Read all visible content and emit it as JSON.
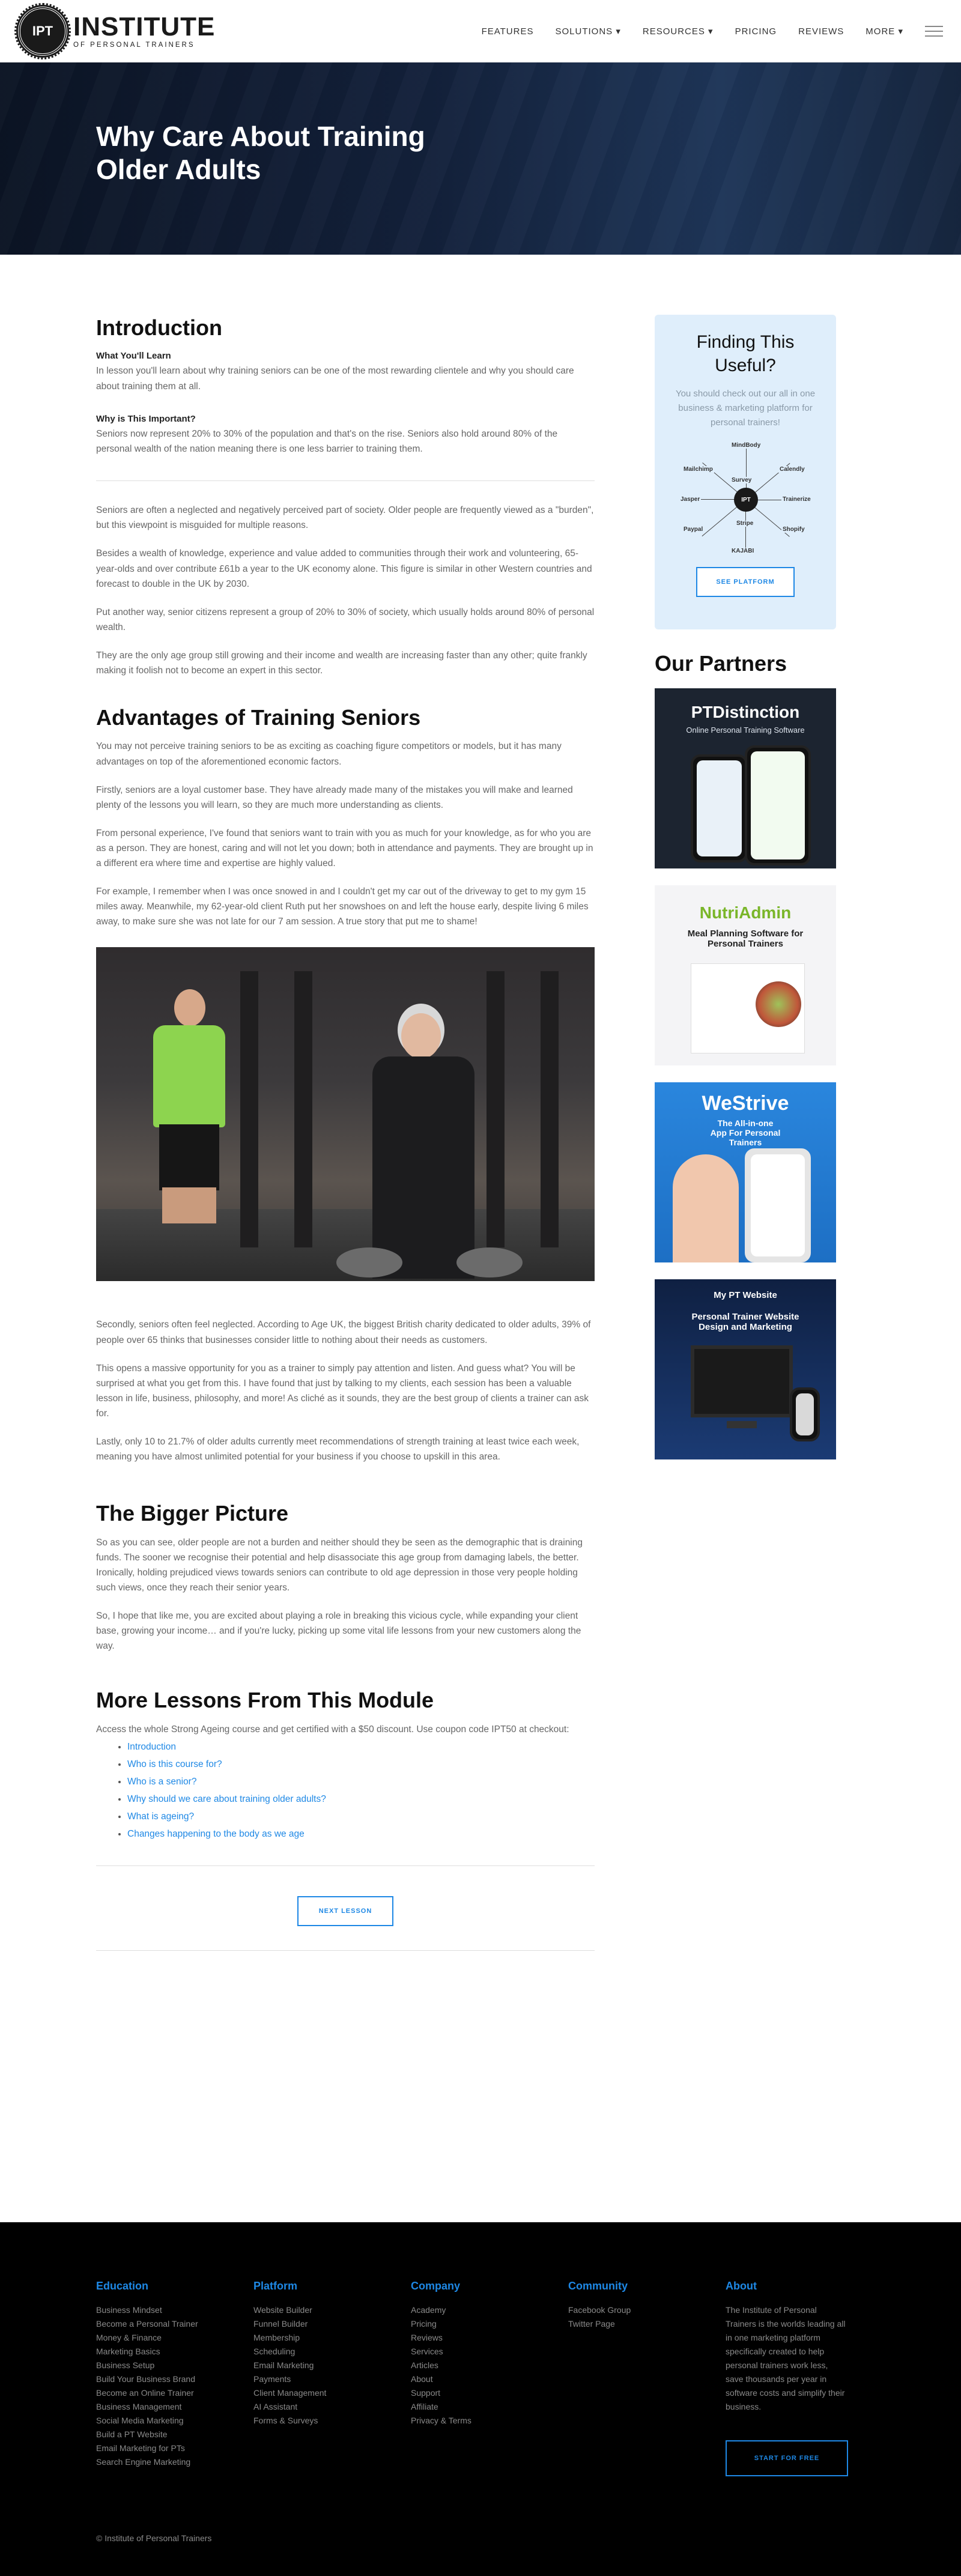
{
  "header": {
    "logo_badge": "IPT",
    "logo_title": "INSTITUTE",
    "logo_sub": "OF PERSONAL TRAINERS",
    "nav": [
      "FEATURES",
      "SOLUTIONS ▾",
      "RESOURCES ▾",
      "PRICING",
      "REVIEWS",
      "MORE ▾"
    ]
  },
  "hero": {
    "title": "Why Care About Training Older Adults"
  },
  "intro": {
    "title": "Introduction",
    "learn_heading": "What You'll Learn",
    "learn_text": "In lesson you'll learn about why training seniors can be one of the most rewarding clientele and why you should care about training them at all.",
    "why_heading": "Why is This Important?",
    "why_text": "Seniors now represent 20% to 30% of the population and that's on the rise. Seniors also hold around 80% of the personal wealth of the nation meaning there is one less barrier to training them."
  },
  "body1": [
    "Seniors are often a neglected and negatively perceived part of society. Older people are frequently viewed as a \"burden\", but this viewpoint is misguided for multiple reasons.",
    "Besides a wealth of knowledge, experience and value added to communities through their work and volunteering, 65-year-olds and over contribute £61b a year to the UK economy alone. This figure is similar in other Western countries and forecast to double in the UK by 2030.",
    "Put another way, senior citizens represent a group of 20% to 30% of society, which usually holds around 80% of personal wealth.",
    "They are the only age group still growing and their income and wealth are increasing faster than any other; quite frankly making it foolish not to become an expert in this sector."
  ],
  "advantages": {
    "title": "Advantages of Training Seniors",
    "paragraphs": [
      "You may not perceive training seniors to be as exciting as coaching figure competitors or models, but it has many advantages on top of the aforementioned economic factors.",
      "Firstly, seniors are a loyal customer base. They have already made many of the mistakes you will make and learned plenty of the lessons you will learn, so they are much more understanding as clients.",
      "From personal experience, I've found that seniors want to train with you as much for your knowledge, as for who you are as a person. They are honest, caring and will not let you down; both in attendance and payments. They are brought up in a different era where time and expertise are highly valued.",
      "For example, I remember when I was once snowed in and I couldn't get my car out of the driveway to get to my gym 15 miles away. Meanwhile, my 62-year-old client Ruth put her snowshoes on and left the house early, despite living 6 miles away, to make sure she was not late for our 7 am session. A true story that put me to shame!"
    ],
    "after_photo": [
      "Secondly, seniors often feel neglected. According to Age UK, the biggest British charity dedicated to older adults, 39% of people over 65 thinks that businesses consider little to nothing about their needs as customers.",
      "This opens a massive opportunity for you as a trainer to simply pay attention and listen. And guess what? You will be surprised at what you get from this. I have found that just by talking to my clients, each session has been a valuable lesson in life, business, philosophy, and more! As cliché as it sounds, they are the best group of clients a trainer can ask for.",
      "Lastly, only 10 to 21.7% of older adults currently meet recommendations of strength training at least twice each week, meaning you have almost unlimited potential for your business if you choose to upskill in this area."
    ]
  },
  "bigger": {
    "title": "The Bigger Picture",
    "paragraphs": [
      "So as you can see, older people are not a burden and neither should they be seen as the demographic that is draining funds. The sooner we recognise their potential and help disassociate this age group from damaging labels, the better. Ironically, holding prejudiced views towards seniors can contribute to old age depression in those very people holding such views, once they reach their senior years.",
      "So, I hope that like me, you are excited about playing a role in breaking this vicious cycle, while expanding your client base, growing your income… and if you're lucky, picking up some vital life lessons from your new customers along the way."
    ]
  },
  "more": {
    "title": "More Lessons From This Module",
    "text": "Access the whole Strong Ageing course and get certified with a $50 discount. Use coupon code IPT50 at checkout:",
    "lessons": [
      "Introduction",
      "Who is this course for?",
      "Who is a senior?",
      "Why should we care about training older adults?",
      "What is ageing?",
      "Changes happening to the body as we age"
    ],
    "next_button": "NEXT LESSON"
  },
  "sidebar": {
    "find_title": "Finding This Useful?",
    "find_text": "You should check out our all in one business & marketing platform for personal trainers!",
    "hub_center": "IPT",
    "hub_labels": [
      "MindBody",
      "Mailchimp",
      "Calendly",
      "Jasper",
      "Stripe",
      "Paypal",
      "Trainerize",
      "Shopify",
      "Survey",
      "KAJABI"
    ],
    "see_button": "SEE PLATFORM",
    "partners_title": "Our Partners",
    "partners": [
      {
        "name": "PTDistinction",
        "tag": "Online Personal Training Software"
      },
      {
        "name": "NutriAdmin",
        "tag": "Meal Planning Software for Personal Trainers"
      },
      {
        "name": "WeStrive",
        "tag": "The All-in-one App For Personal Trainers"
      },
      {
        "name": "My PT Website",
        "tag": "Personal Trainer Website Design and Marketing"
      }
    ]
  },
  "footer": {
    "columns": [
      {
        "title": "Education",
        "links": [
          "Business Mindset",
          "Become a Personal Trainer",
          "Money & Finance",
          "Marketing Basics",
          "Business Setup",
          "Build Your Business Brand",
          "Become an Online Trainer",
          "Business Management",
          "Social Media Marketing",
          "Build a PT Website",
          "Email Marketing for PTs",
          "Search Engine Marketing"
        ]
      },
      {
        "title": "Platform",
        "links": [
          "Website Builder",
          "Funnel Builder",
          "Membership",
          "Scheduling",
          "Email Marketing",
          "Payments",
          "Client Management",
          "AI Assistant",
          "Forms & Surveys"
        ]
      },
      {
        "title": "Company",
        "links": [
          "Academy",
          "Pricing",
          "Reviews",
          "Services",
          "Articles",
          "About",
          "Support",
          "Affiliate",
          "Privacy & Terms"
        ]
      },
      {
        "title": "Community",
        "links": [
          "Facebook Group",
          "Twitter Page"
        ]
      }
    ],
    "about_title": "About",
    "about_text": "The Institute of Personal Trainers is the worlds leading all in one marketing platform specifically created to help personal trainers work less, save thousands per year in software costs and simplify their business.",
    "start_button": "START FOR FREE",
    "copyright": "© Institute of Personal Trainers"
  }
}
